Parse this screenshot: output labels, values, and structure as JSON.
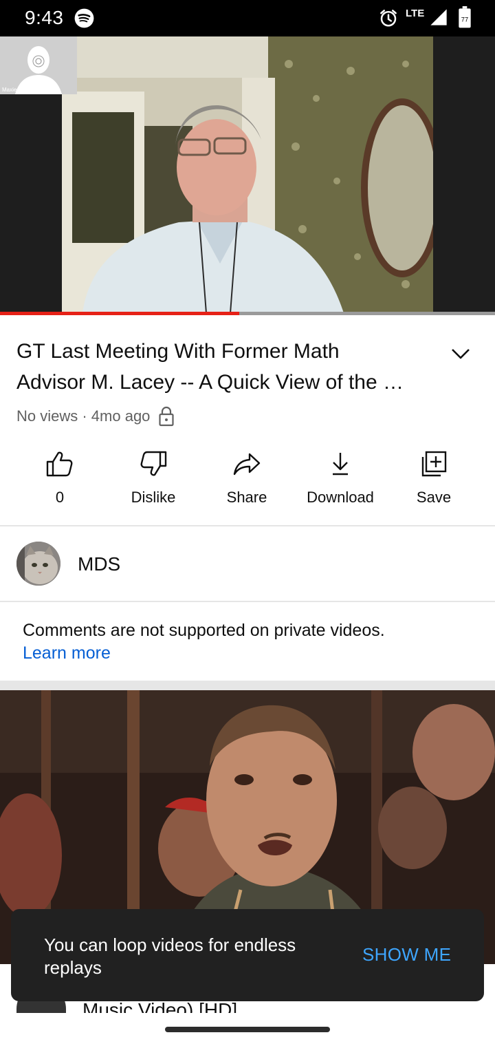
{
  "status_bar": {
    "time": "9:43",
    "network": "LTE",
    "battery_label": "77",
    "icons": [
      "spotify-icon",
      "alarm-icon",
      "signal-icon",
      "battery-icon"
    ]
  },
  "player": {
    "participant_name": "Maxie Schmidt",
    "progress_fraction": 0.483,
    "progress_color": "#e62117"
  },
  "video": {
    "title_line1": "GT Last Meeting With Former Math",
    "title_line2": "Advisor M. Lacey -- A Quick View of the …",
    "meta": "No views · 4mo ago",
    "privacy_icon": "lock-icon"
  },
  "actions": [
    {
      "label": "0",
      "icon": "like-icon"
    },
    {
      "label": "Dislike",
      "icon": "dislike-icon"
    },
    {
      "label": "Share",
      "icon": "share-icon"
    },
    {
      "label": "Download",
      "icon": "download-icon"
    },
    {
      "label": "Save",
      "icon": "save-icon"
    }
  ],
  "channel": {
    "name": "MDS"
  },
  "comments": {
    "message": "Comments are not supported on private videos.",
    "link": "Learn more",
    "link_color": "#065fd4"
  },
  "next_video": {
    "title_peek": "Music Video) [HD]"
  },
  "snackbar": {
    "text": "You can loop videos for endless replays",
    "action": "SHOW ME",
    "action_color": "#3ea6ff"
  }
}
